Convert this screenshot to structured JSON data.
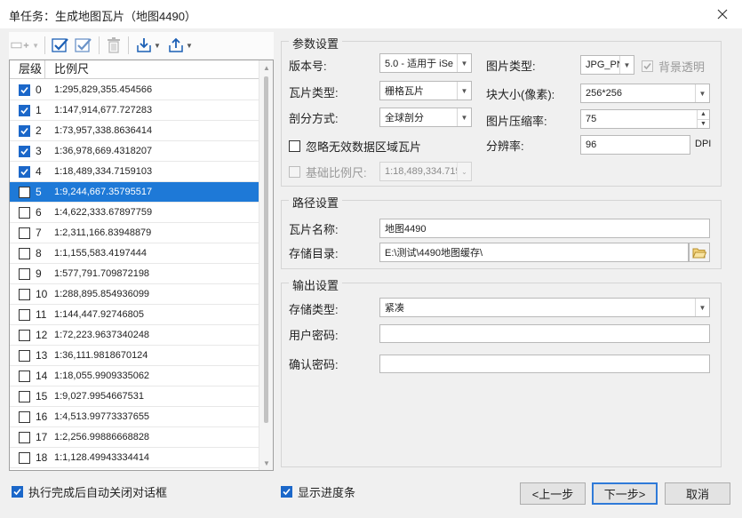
{
  "window": {
    "title": "单任务：生成地图瓦片（地图4490）",
    "close_icon": "close-icon"
  },
  "toolbar": {
    "icons": [
      "add-layer-icon",
      "check-all-icon",
      "check-selected-icon",
      "delete-icon",
      "import-icon",
      "export-icon"
    ]
  },
  "table": {
    "headers": {
      "level": "层级",
      "scale": "比例尺"
    },
    "rows": [
      {
        "level": "0",
        "scale": "1:295,829,355.454566",
        "checked": true
      },
      {
        "level": "1",
        "scale": "1:147,914,677.727283",
        "checked": true
      },
      {
        "level": "2",
        "scale": "1:73,957,338.8636414",
        "checked": true
      },
      {
        "level": "3",
        "scale": "1:36,978,669.4318207",
        "checked": true
      },
      {
        "level": "4",
        "scale": "1:18,489,334.7159103",
        "checked": true
      },
      {
        "level": "5",
        "scale": "1:9,244,667.35795517",
        "checked": false,
        "selected": true
      },
      {
        "level": "6",
        "scale": "1:4,622,333.67897759",
        "checked": false
      },
      {
        "level": "7",
        "scale": "1:2,311,166.83948879",
        "checked": false
      },
      {
        "level": "8",
        "scale": "1:1,155,583.4197444",
        "checked": false
      },
      {
        "level": "9",
        "scale": "1:577,791.709872198",
        "checked": false
      },
      {
        "level": "10",
        "scale": "1:288,895.854936099",
        "checked": false
      },
      {
        "level": "11",
        "scale": "1:144,447.92746805",
        "checked": false
      },
      {
        "level": "12",
        "scale": "1:72,223.9637340248",
        "checked": false
      },
      {
        "level": "13",
        "scale": "1:36,111.9818670124",
        "checked": false
      },
      {
        "level": "14",
        "scale": "1:18,055.9909335062",
        "checked": false
      },
      {
        "level": "15",
        "scale": "1:9,027.9954667531",
        "checked": false
      },
      {
        "level": "16",
        "scale": "1:4,513.99773337655",
        "checked": false
      },
      {
        "level": "17",
        "scale": "1:2,256.99886668828",
        "checked": false
      },
      {
        "level": "18",
        "scale": "1:1,128.49943334414",
        "checked": false
      }
    ]
  },
  "params": {
    "title": "参数设置",
    "version_label": "版本号:",
    "version_value": "5.0 - 适用于 iSe",
    "tile_type_label": "瓦片类型:",
    "tile_type_value": "栅格瓦片",
    "split_label": "剖分方式:",
    "split_value": "全球剖分",
    "ignore_invalid_label": "忽略无效数据区域瓦片",
    "ignore_invalid_checked": false,
    "base_scale_label": "基础比例尺:",
    "base_scale_value": "1:18,489,334.715",
    "image_type_label": "图片类型:",
    "image_type_value": "JPG_PN",
    "bg_transparent_label": "背景透明",
    "bg_transparent_checked": true,
    "block_size_label": "块大小(像素):",
    "block_size_value": "256*256",
    "compression_label": "图片压缩率:",
    "compression_value": "75",
    "resolution_label": "分辨率:",
    "resolution_value": "96",
    "resolution_unit": "DPI"
  },
  "path": {
    "title": "路径设置",
    "name_label": "瓦片名称:",
    "name_value": "地图4490",
    "dir_label": "存储目录:",
    "dir_value": "E:\\测试\\4490地图缓存\\"
  },
  "output": {
    "title": "输出设置",
    "storage_type_label": "存储类型:",
    "storage_type_value": "紧凑",
    "user_password_label": "用户密码:",
    "user_password_value": "",
    "confirm_password_label": "确认密码:",
    "confirm_password_value": ""
  },
  "footer": {
    "auto_close_label": "执行完成后自动关闭对话框",
    "auto_close_checked": true,
    "show_progress_label": "显示进度条",
    "show_progress_checked": true,
    "prev_label": "<上一步",
    "next_label": "下一步>",
    "cancel_label": "取消"
  },
  "colors": {
    "selection": "#1e79d7",
    "checkbox_on": "#1b67c9",
    "toolbar_icon": "#1b5fb5"
  }
}
